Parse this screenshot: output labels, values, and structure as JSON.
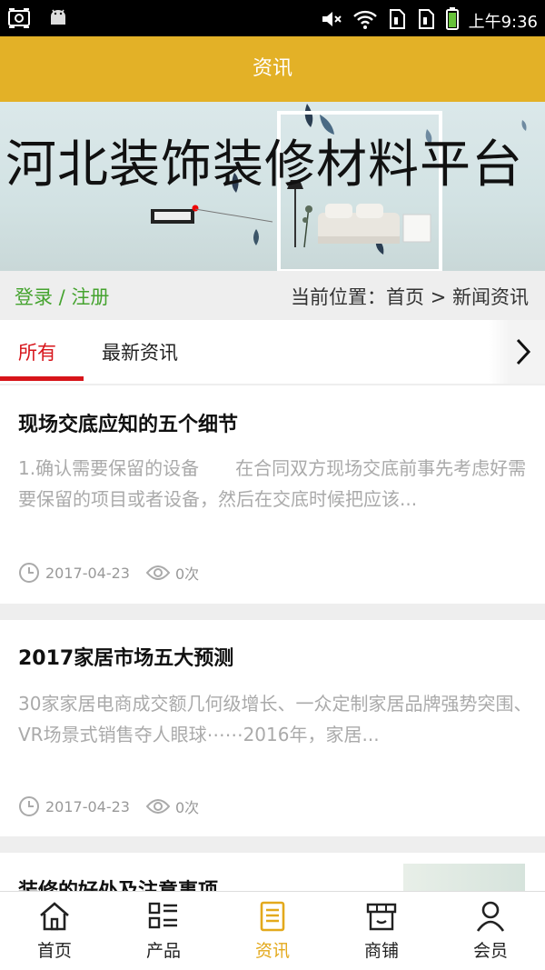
{
  "status_bar": {
    "time": "上午9:36"
  },
  "header": {
    "title": "资讯"
  },
  "banner": {
    "title": "河北装饰装修材料平台"
  },
  "login": {
    "label": "登录 / 注册"
  },
  "breadcrumb": {
    "text": "当前位置：首页 > 新闻资讯"
  },
  "tabs": [
    {
      "label": "所有",
      "active": true
    },
    {
      "label": "最新资讯",
      "active": false
    }
  ],
  "articles": [
    {
      "title": "现场交底应知的五个细节",
      "summary": "1.确认需要保留的设备　　在合同双方现场交底前事先考虑好需要保留的项目或者设备，然后在交底时候把应该...",
      "date": "2017-04-23",
      "views": "0次"
    },
    {
      "title": "2017家居市场五大预测",
      "summary": "30家家居电商成交额几何级增长、一众定制家居品牌强势突围、VR场景式销售夺人眼球⋯⋯2016年，家居...",
      "date": "2017-04-23",
      "views": "0次"
    },
    {
      "title": "装修的好处及注意事项"
    }
  ],
  "bottom_nav": [
    {
      "label": "首页",
      "icon": "home-icon"
    },
    {
      "label": "产品",
      "icon": "list-icon"
    },
    {
      "label": "资讯",
      "icon": "document-icon",
      "active": true
    },
    {
      "label": "商铺",
      "icon": "shop-icon"
    },
    {
      "label": "会员",
      "icon": "person-icon"
    }
  ],
  "colors": {
    "header": "#e3b127",
    "active_tab": "#d7141a",
    "login_link": "#45a32f",
    "nav_active": "#e3a91c"
  }
}
